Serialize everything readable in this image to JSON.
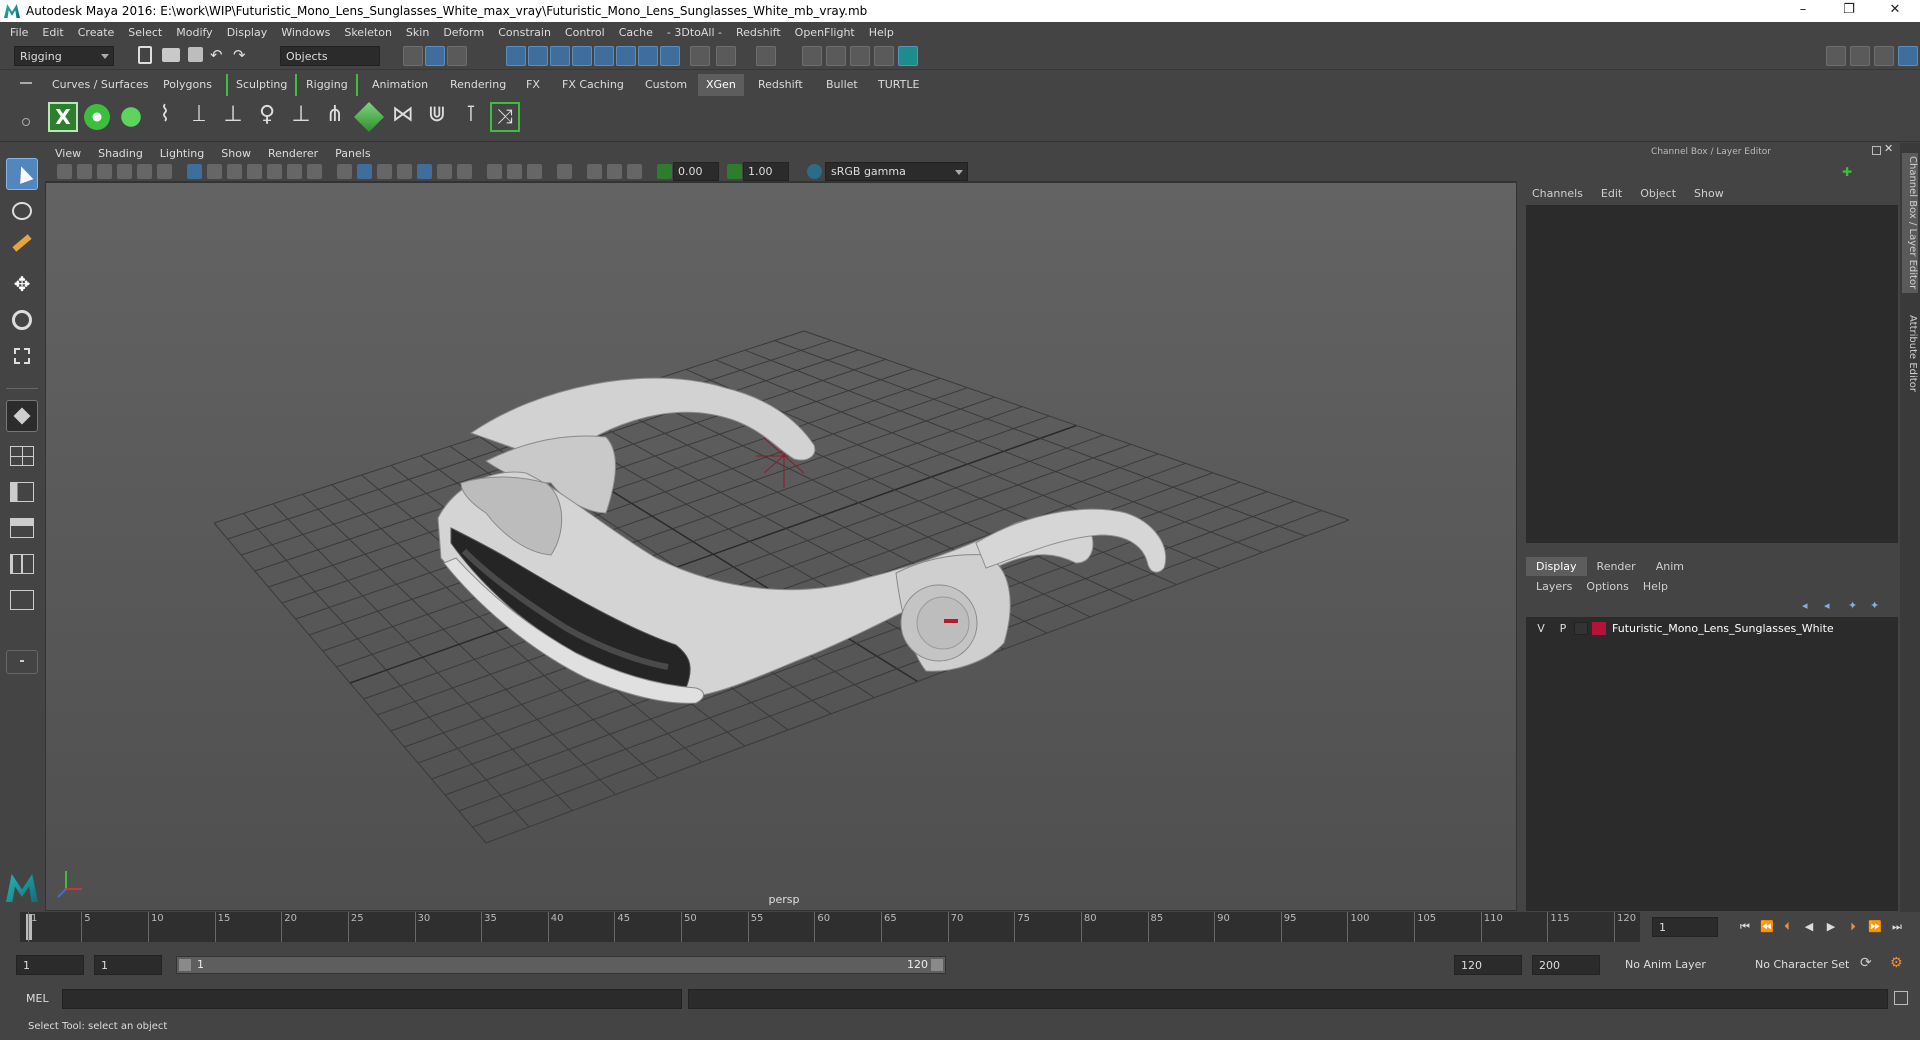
{
  "window": {
    "title": "Autodesk Maya 2016: E:\\work\\WIP\\Futuristic_Mono_Lens_Sunglasses_White_max_vray\\Futuristic_Mono_Lens_Sunglasses_White_mb_vray.mb",
    "minimize": "–",
    "restore": "❐",
    "close": "✕"
  },
  "menu": [
    "File",
    "Edit",
    "Create",
    "Select",
    "Modify",
    "Display",
    "Windows",
    "Skeleton",
    "Skin",
    "Deform",
    "Constrain",
    "Control",
    "Cache",
    "- 3DtoAll -",
    "Redshift",
    "OpenFlight",
    "Help"
  ],
  "statusline": {
    "menuset": "Rigging",
    "selection_mode": "Objects"
  },
  "shelf_tabs": [
    "Curves / Surfaces",
    "Polygons",
    "Sculpting",
    "Rigging",
    "Animation",
    "Rendering",
    "FX",
    "FX Caching",
    "Custom",
    "XGen",
    "Redshift",
    "Bullet",
    "TURTLE"
  ],
  "active_shelf_tab": "XGen",
  "panel_menu": [
    "View",
    "Shading",
    "Lighting",
    "Show",
    "Renderer",
    "Panels"
  ],
  "panel_toolbar": {
    "exposure": "0.00",
    "gamma": "1.00",
    "color_space": "sRGB gamma"
  },
  "viewport": {
    "camera_label": "persp"
  },
  "channel_box": {
    "header": "Channel Box / Layer Editor",
    "menu": [
      "Channels",
      "Edit",
      "Object",
      "Show"
    ]
  },
  "layer_editor": {
    "tabs": [
      "Display",
      "Render",
      "Anim"
    ],
    "active_tab": "Display",
    "menu": [
      "Layers",
      "Options",
      "Help"
    ],
    "layers": [
      {
        "v": "V",
        "p": "P",
        "name": "Futuristic_Mono_Lens_Sunglasses_White",
        "color": "#b3133a"
      }
    ]
  },
  "side_tabs": [
    "Channel Box / Layer Editor",
    "Attribute Editor"
  ],
  "timeline": {
    "ticks": [
      "1",
      "5",
      "10",
      "15",
      "20",
      "25",
      "30",
      "35",
      "40",
      "45",
      "50",
      "55",
      "60",
      "65",
      "70",
      "75",
      "80",
      "85",
      "90",
      "95",
      "100",
      "105",
      "110",
      "115",
      "120"
    ],
    "current_frame": "1"
  },
  "range": {
    "start": "1",
    "playback_start": "1",
    "slider_start": "1",
    "slider_end": "120",
    "playback_end": "120",
    "end": "200",
    "anim_layer": "No Anim Layer",
    "character_set": "No Character Set"
  },
  "command": {
    "label": "MEL"
  },
  "help": {
    "text": "Select Tool: select an object"
  },
  "colors": {
    "accent_blue": "#3f6e9c",
    "shelf_green": "#3cbf3c",
    "layer_red": "#b3133a"
  }
}
